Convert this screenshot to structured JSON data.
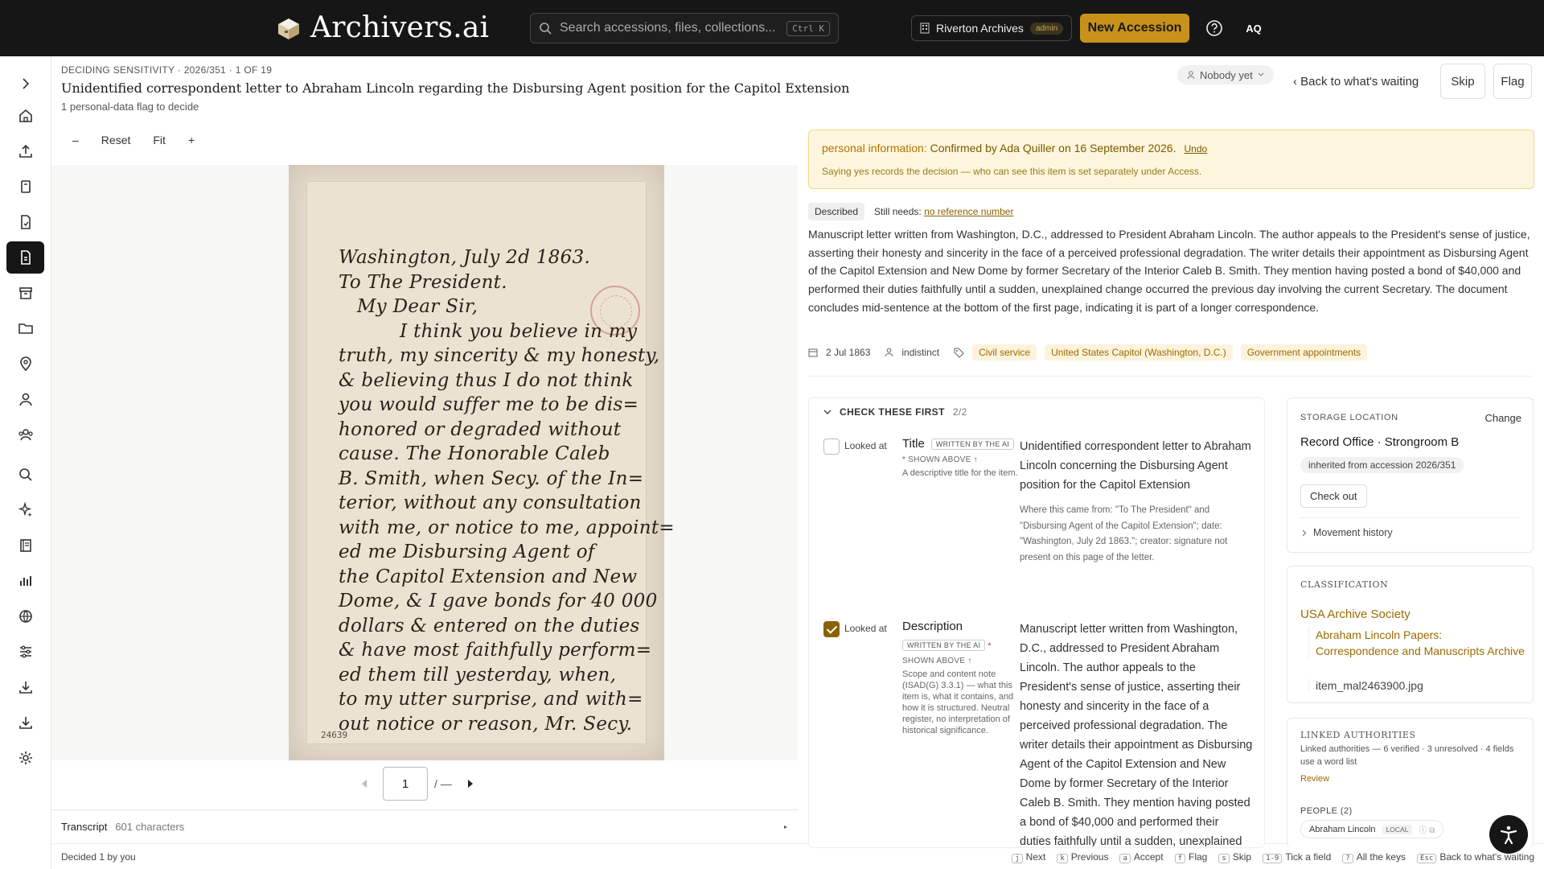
{
  "app": {
    "brand": "Archivers.ai",
    "search_placeholder": "Search accessions, files, collections...",
    "search_shortcut": "Ctrl K",
    "org_name": "Riverton Archives",
    "org_role": "admin",
    "new_accession": "New Accession",
    "avatar": "AQ"
  },
  "header": {
    "eyebrow": "DECIDING SENSITIVITY · 2026/351 · 1 OF 19",
    "title": "Unidentified correspondent letter to Abraham Lincoln regarding the Disbursing Agent position for the Capitol Extension",
    "subtitle": "1 personal-data flag to decide",
    "assignee": "Nobody yet",
    "back": "‹ Back to what's waiting",
    "skip": "Skip",
    "flag": "Flag"
  },
  "viewer": {
    "minus": "–",
    "reset": "Reset",
    "fit": "Fit",
    "plus": "+",
    "page_input": "1",
    "page_total": "/ —",
    "sheet_number": "24639",
    "handwriting": "Washington, July 2d 1863.\nTo The President.\n   My Dear Sir,\n          I think you believe in my\ntruth, my sincerity & my honesty,\n& believing thus I do not think\nyou would suffer me to be dis=\nhonored or degraded without\ncause. The Honorable Caleb\nB. Smith, when Secy. of the In=\nterior, without any consultation\nwith me, or notice to me, appoint=\ned me Disbursing Agent of\nthe Capitol Extension and New\nDome, & I gave bonds for 40 000\ndollars & entered on the duties\n& have most faithfully perform=\ned them till yesterday, when,\nto my utter surprise, and with=\nout notice or reason, Mr. Secy."
  },
  "transcript": {
    "label": "Transcript",
    "count": "601 characters"
  },
  "footer": {
    "decided": "Decided 1 by you",
    "keys": [
      {
        "k": "j",
        "label": "Next"
      },
      {
        "k": "k",
        "label": "Previous"
      },
      {
        "k": "a",
        "label": "Accept"
      },
      {
        "k": "f",
        "label": "Flag"
      },
      {
        "k": "s",
        "label": "Skip"
      },
      {
        "k": "1-9",
        "label": "Tick a field"
      },
      {
        "k": "?",
        "label": "All the keys"
      },
      {
        "k": "Esc",
        "label": "Back to what's waiting"
      }
    ]
  },
  "notice": {
    "prefix": "personal information:",
    "text": "Confirmed by Ada Quiller on 16 September 2026.",
    "undo": "Undo",
    "note": "Saying yes records the decision — who can see this item is set separately under Access."
  },
  "status": {
    "chip": "Described",
    "still_label": "Still needs:",
    "still_link": "no reference number"
  },
  "description": "Manuscript letter written from Washington, D.C., addressed to President Abraham Lincoln. The author appeals to the President's sense of justice, asserting their honesty and sincerity in the face of a perceived professional degradation. The writer details their appointment as Disbursing Agent of the Capitol Extension and New Dome by former Secretary of the Interior Caleb B. Smith. They mention having posted a bond of $40,000 and performed their duties faithfully until a sudden, unexplained change occurred the previous day involving the current Secretary. The document concludes mid-sentence at the bottom of the first page, indicating it is part of a longer correspondence.",
  "meta": {
    "date": "2 Jul 1863",
    "creator": "indistinct",
    "tags": [
      "Civil service",
      "United States Capitol (Washington, D.C.)",
      "Government appointments"
    ]
  },
  "check": {
    "heading": "CHECK THESE FIRST",
    "count": "2/2",
    "looked": "Looked at",
    "ai": "WRITTEN BY THE AI",
    "shown": "SHOWN ABOVE ↑",
    "title_field": {
      "name": "Title",
      "help": "A descriptive title for the item.",
      "value": "Unidentified correspondent letter to Abraham Lincoln concerning the Disbursing Agent position for the Capitol Extension",
      "source": "Where this came from: \"To The President\" and \"Disbursing Agent of the Capitol Extension\"; date: \"Washington, July 2d 1863.\"; creator: signature not present on this page of the letter."
    },
    "desc_field": {
      "name": "Description",
      "help": "Scope and content note (ISAD(G) 3.3.1) — what this item is, what it contains, and how it is structured. Neutral register, no interpretation of historical significance.",
      "value": "Manuscript letter written from Washington, D.C., addressed to President Abraham Lincoln. The author appeals to the President's sense of justice, asserting their honesty and sincerity in the face of a perceived professional degradation. The writer details their appointment as Disbursing Agent of the Capitol Extension and New Dome by former Secretary of the Interior Caleb B. Smith. They mention having posted a bond of $40,000 and performed their duties faithfully until a sudden, unexplained change occurred the previous day involving the current Secretary."
    }
  },
  "storage": {
    "label": "STORAGE LOCATION",
    "change": "Change",
    "location": "Record Office · Strongroom B",
    "inherited": "inherited from accession 2026/351",
    "checkout": "Check out",
    "history": "Movement history"
  },
  "classification": {
    "label": "CLASSIFICATION",
    "root": "USA Archive Society",
    "child": "Abraham Lincoln Papers: Correspondence and Manuscripts Archive",
    "file": "item_mal2463900.jpg"
  },
  "authorities": {
    "label": "LINKED AUTHORITIES",
    "summary": "Linked authorities — 6 verified · 3 unresolved · 4 fields use a word list",
    "review": "Review",
    "people": "PEOPLE (2)",
    "person": "Abraham Lincoln",
    "person_badge": "LOCAL"
  }
}
